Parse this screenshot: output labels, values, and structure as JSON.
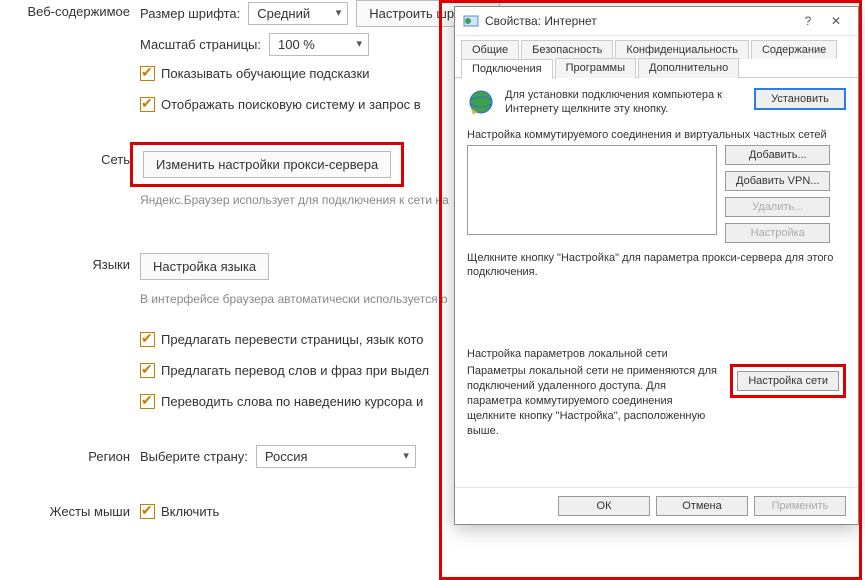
{
  "settings": {
    "sections": {
      "web_content": "Веб-содержимое",
      "network": "Сеть",
      "languages": "Языки",
      "region": "Регион",
      "mouse_gestures": "Жесты мыши"
    },
    "font_size_label": "Размер шрифта:",
    "font_size_value": "Средний",
    "font_button": "Настроить шрифты",
    "zoom_label": "Масштаб страницы:",
    "zoom_value": "100 %",
    "chk_hints": "Показывать обучающие подсказки",
    "chk_show_search": "Отображать поисковую систему и запрос в",
    "proxy_button": "Изменить настройки прокси-сервера",
    "proxy_note": "Яндекс.Браузер использует для подключения к сети на",
    "lang_button": "Настройка языка",
    "lang_note": "В интерфейсе браузера автоматически используется о",
    "chk_translate_pages": "Предлагать перевести страницы, язык кото",
    "chk_translate_words": "Предлагать перевод слов и фраз при выдел",
    "chk_hover_translate": "Переводить слова по наведению курсора и",
    "country_label": "Выберите страну:",
    "country_value": "Россия",
    "chk_enable_gestures": "Включить"
  },
  "dialog": {
    "title": "Свойства: Интернет",
    "help_glyph": "?",
    "close_glyph": "✕",
    "tabs": {
      "general": "Общие",
      "security": "Безопасность",
      "privacy": "Конфиденциальность",
      "content": "Содержание",
      "connections": "Подключения",
      "programs": "Программы",
      "advanced": "Дополнительно"
    },
    "install_text": "Для установки подключения компьютера к Интернету щелкните эту кнопку.",
    "install_btn": "Установить",
    "dialup_label": "Настройка коммутируемого соединения и виртуальных частных сетей",
    "add_btn": "Добавить...",
    "add_vpn_btn": "Добавить VPN...",
    "delete_btn": "Удалить...",
    "settings_btn": "Настройка",
    "proxy_hint": "Щелкните кнопку \"Настройка\" для параметра прокси-сервера для этого подключения.",
    "lan_label": "Настройка параметров локальной сети",
    "lan_text": "Параметры локальной сети не применяются для подключений удаленного доступа. Для параметра коммутируемого соединения щелкните кнопку \"Настройка\", расположенную выше.",
    "lan_btn": "Настройка сети",
    "ok": "ОК",
    "cancel": "Отмена",
    "apply": "Применить"
  }
}
